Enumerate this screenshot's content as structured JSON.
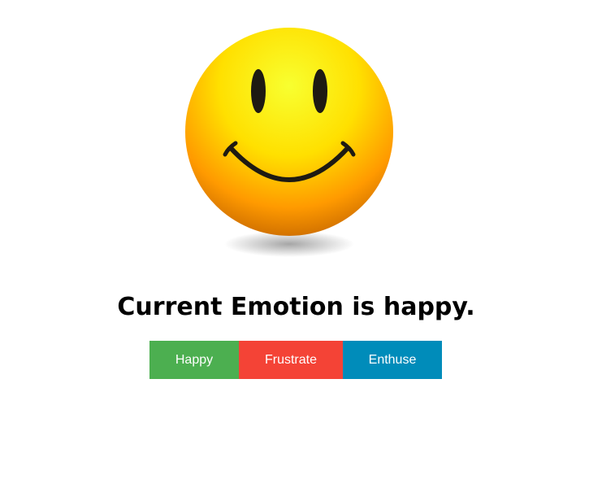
{
  "emotion_heading": "Current Emotion is happy.",
  "emoji": {
    "icon": "smiley-face-icon",
    "state": "happy",
    "colors": {
      "face_top": "#f7ff2a",
      "face_mid": "#ffd400",
      "face_bottom": "#ff8a00",
      "features": "#1e1a12"
    }
  },
  "buttons": {
    "happy": {
      "label": "Happy",
      "color": "#4caf50"
    },
    "frustrate": {
      "label": "Frustrate",
      "color": "#f44336"
    },
    "enthuse": {
      "label": "Enthuse",
      "color": "#008cba"
    }
  }
}
